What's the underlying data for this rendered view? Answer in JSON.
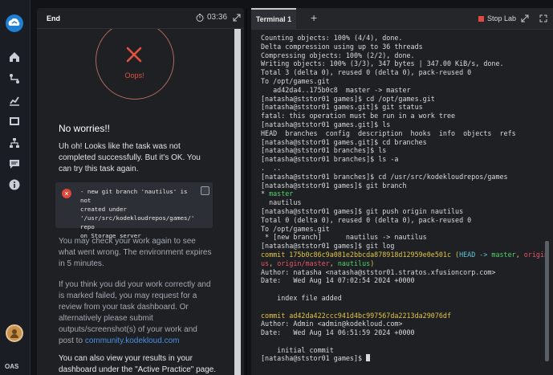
{
  "rail": {
    "icons": [
      "cloud-logo-icon",
      "home-icon",
      "route-icon",
      "chart-icon",
      "film-icon",
      "sitemap-icon",
      "chat-icon",
      "info-icon"
    ],
    "user_initials": "OAS"
  },
  "left": {
    "tab_label": "End",
    "timer": "03:36",
    "oops": "Oops!",
    "heading": "No worries!!",
    "intro": "Uh oh! Looks like the task was not completed successfully. But it's OK. You can try this task again.",
    "error_lines": [
      "- new git branch 'nautilus' is not",
      "created under",
      "'/usr/src/kodekloudrepos/games/' repo",
      "on Storage server"
    ],
    "para_check": "You may check your work again to see what went wrong. The environment expires in 5 minutes.",
    "para_review": "If you think you did your work correctly and is marked failed, you may request for a review from your task dashboard. Or alternatively please submit outputs/screenshot(s) of your work and post to ",
    "community_link": "community.kodekloud.com",
    "para_results": "You can also view your results in your dashboard under the \"Active Practice\" page."
  },
  "terminal": {
    "tab_label": "Terminal 1",
    "new_tab": "+",
    "stop_label": "Stop Lab",
    "lines": [
      [
        {
          "t": "Counting objects: 100% (4/4), done."
        }
      ],
      [
        {
          "t": "Delta compression using up to 36 threads"
        }
      ],
      [
        {
          "t": "Compressing objects: 100% (2/2), done."
        }
      ],
      [
        {
          "t": "Writing objects: 100% (3/3), 347 bytes | 347.00 KiB/s, done."
        }
      ],
      [
        {
          "t": "Total 3 (delta 0), reused 0 (delta 0), pack-reused 0"
        }
      ],
      [
        {
          "t": "To /opt/games.git"
        }
      ],
      [
        {
          "t": "   ad42da4..175b0c8  master -> master"
        }
      ],
      [
        {
          "t": "[natasha@ststor01 games]$ cd /opt/games.git"
        }
      ],
      [
        {
          "t": "[natasha@ststor01 games.git]$ git status"
        }
      ],
      [
        {
          "t": "fatal: this operation must be run in a work tree"
        }
      ],
      [
        {
          "t": "[natasha@ststor01 games.git]$ ls"
        }
      ],
      [
        {
          "t": "HEAD  branches  config  description  hooks  info  objects  refs"
        }
      ],
      [
        {
          "t": "[natasha@ststor01 games.git]$ cd branches"
        }
      ],
      [
        {
          "t": "[natasha@ststor01 branches]$ ls"
        }
      ],
      [
        {
          "t": "[natasha@ststor01 branches]$ ls -a"
        }
      ],
      [
        {
          "t": ".  .."
        }
      ],
      [
        {
          "t": "[natasha@ststor01 branches]$ cd /usr/src/kodekloudrepos/games"
        }
      ],
      [
        {
          "t": "[natasha@ststor01 games]$ git branch"
        }
      ],
      [
        {
          "t": "* "
        },
        {
          "t": "master",
          "c": "t-green"
        }
      ],
      [
        {
          "t": "  nautilus"
        }
      ],
      [
        {
          "t": "[natasha@ststor01 games]$ git push origin nautilus"
        }
      ],
      [
        {
          "t": "Total 0 (delta 0), reused 0 (delta 0), pack-reused 0"
        }
      ],
      [
        {
          "t": "To /opt/games.git"
        }
      ],
      [
        {
          "t": " * [new branch]      nautilus -> nautilus"
        }
      ],
      [
        {
          "t": "[natasha@ststor01 games]$ git log"
        }
      ],
      [
        {
          "t": "commit 175b0c86c9a081e2bbcda878918d12959e0e501c ",
          "c": "t-yellow"
        },
        {
          "t": "(",
          "c": "t-yellow"
        },
        {
          "t": "HEAD -> ",
          "c": "t-cyan"
        },
        {
          "t": "master",
          "c": "t-green"
        },
        {
          "t": ", ",
          "c": "t-yellow"
        },
        {
          "t": "origin/nautil",
          "c": "t-red"
        }
      ],
      [
        {
          "t": "us",
          "c": "t-red"
        },
        {
          "t": ", ",
          "c": "t-yellow"
        },
        {
          "t": "origin/master",
          "c": "t-red"
        },
        {
          "t": ", ",
          "c": "t-yellow"
        },
        {
          "t": "nautilus",
          "c": "t-green"
        },
        {
          "t": ")",
          "c": "t-yellow"
        }
      ],
      [
        {
          "t": "Author: natasha <natasha@ststor01.stratos.xfusioncorp.com>"
        }
      ],
      [
        {
          "t": "Date:   Wed Aug 14 07:02:54 2024 +0000"
        }
      ],
      [
        {
          "t": ""
        }
      ],
      [
        {
          "t": "    index file added"
        }
      ],
      [
        {
          "t": ""
        }
      ],
      [
        {
          "t": "commit ad42da422ccc941d4bc997567da2213da29076df",
          "c": "t-yellow"
        }
      ],
      [
        {
          "t": "Author: Admin <admin@kodekloud.com>"
        }
      ],
      [
        {
          "t": "Date:   Wed Aug 14 06:51:59 2024 +0000"
        }
      ],
      [
        {
          "t": ""
        }
      ],
      [
        {
          "t": "    initial commit"
        }
      ],
      [
        {
          "t": "[natasha@ststor01 games]$ "
        }
      ]
    ]
  },
  "colors": {
    "accent_red": "#e0533f",
    "link_blue": "#4c8ee0",
    "git_green": "#4fd36a",
    "git_yellow": "#e0c548",
    "git_cyan": "#5ec5d8",
    "git_red": "#e9526a"
  }
}
